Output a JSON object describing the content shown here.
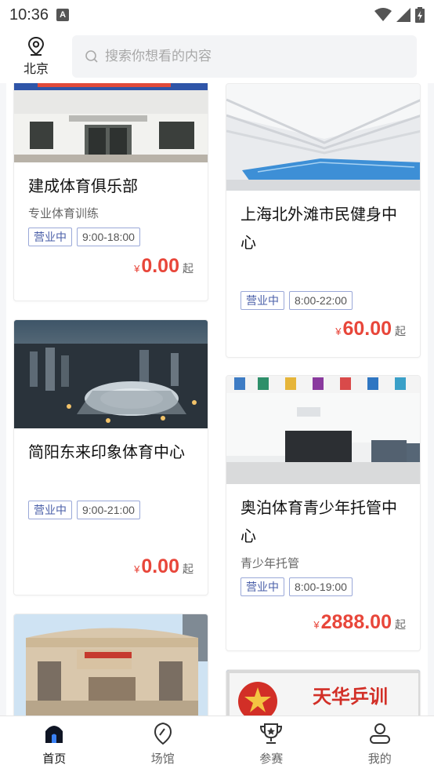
{
  "status": {
    "time": "10:36",
    "notif": "A"
  },
  "header": {
    "city": "北京",
    "search_placeholder": "搜索你想看的内容"
  },
  "venues": [
    {
      "title": "建成体育俱乐部",
      "subtitle": "专业体育训练",
      "status": "营业中",
      "hours": "9:00-18:00",
      "currency": "¥",
      "price": "0.00",
      "suffix": "起"
    },
    {
      "title": "上海北外滩市民健身中心",
      "subtitle": "",
      "status": "营业中",
      "hours": "8:00-22:00",
      "currency": "¥",
      "price": "60.00",
      "suffix": "起"
    },
    {
      "title": "简阳东来印象体育中心",
      "subtitle": "",
      "status": "营业中",
      "hours": "9:00-21:00",
      "currency": "¥",
      "price": "0.00",
      "suffix": "起"
    },
    {
      "title": "奥泊体育青少年托管中心",
      "subtitle": "青少年托管",
      "status": "营业中",
      "hours": "8:00-19:00",
      "currency": "¥",
      "price": "2888.00",
      "suffix": "起"
    }
  ],
  "image_text": {
    "tianhua": "天华乒训"
  },
  "nav": [
    {
      "label": "首页",
      "icon": "home-icon"
    },
    {
      "label": "场馆",
      "icon": "location-icon"
    },
    {
      "label": "参赛",
      "icon": "trophy-icon"
    },
    {
      "label": "我的",
      "icon": "user-icon"
    }
  ],
  "colors": {
    "price": "#e8463a",
    "tag_border": "#9aa8d8",
    "tag_text": "#4a5fa8"
  }
}
